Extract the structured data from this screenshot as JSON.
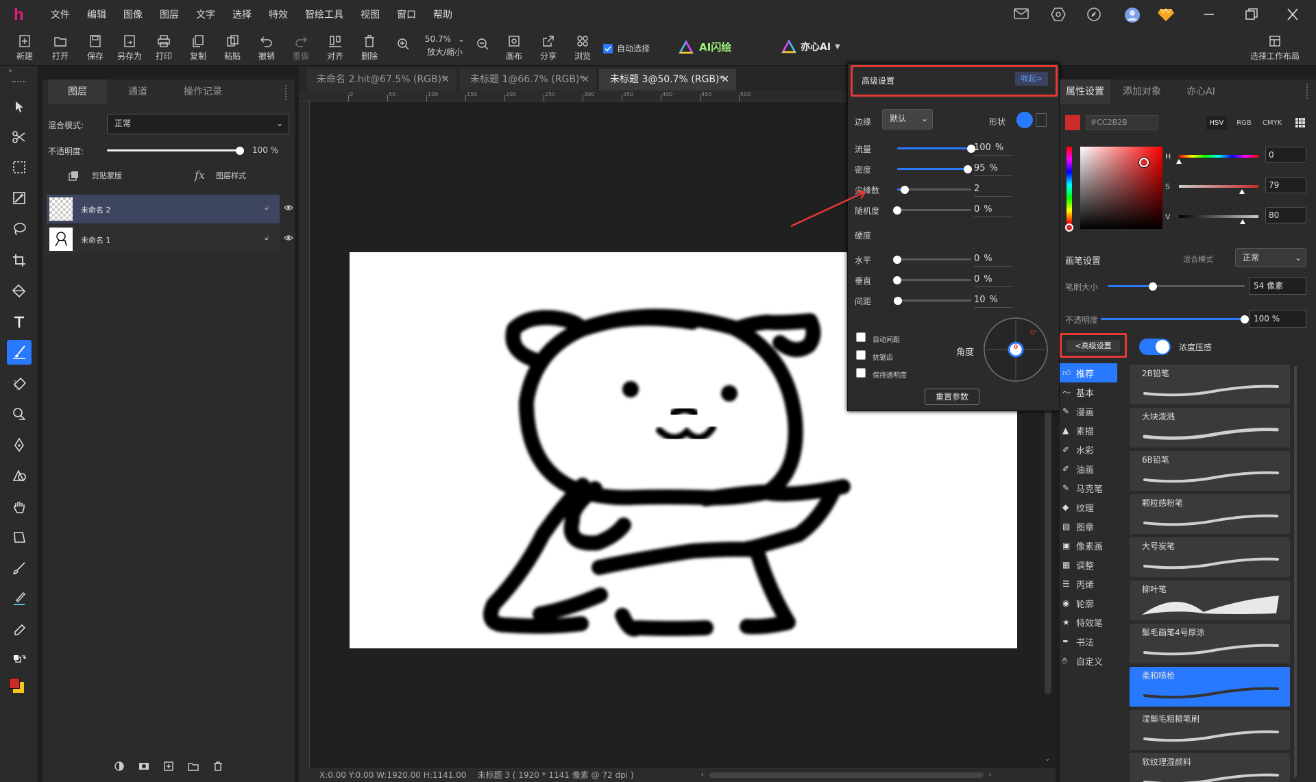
{
  "menubar": {
    "logo": "h",
    "items": [
      "文件",
      "编辑",
      "图像",
      "图层",
      "文字",
      "选择",
      "特效",
      "智绘工具",
      "视图",
      "窗口",
      "帮助"
    ]
  },
  "toolbar": {
    "buttons": [
      "新建",
      "打开",
      "保存",
      "另存为",
      "打印",
      "复制",
      "粘贴",
      "撤销",
      "重做",
      "对齐",
      "删除"
    ],
    "zoom_value": "50.7%",
    "zoom_label": "放大/缩小",
    "canvas_label": "画布",
    "share_label": "分享",
    "browse_label": "浏览",
    "auto_select": "自动选择",
    "ai_flash": "AI闪绘",
    "yixin_ai": "亦心AI",
    "layout_label": "选择工作布局"
  },
  "layers_panel": {
    "tabs": [
      "图层",
      "通道",
      "操作记录"
    ],
    "blend_label": "混合模式:",
    "blend_value": "正常",
    "opacity_label": "不透明度:",
    "opacity_value": "100",
    "opacity_unit": "%",
    "opacity_fraction": 1.0,
    "clip_mask": "剪贴蒙版",
    "layer_style": "图层样式",
    "layers": [
      {
        "name": "未命名 2",
        "selected": true
      },
      {
        "name": "未命名 1",
        "selected": false
      }
    ]
  },
  "doc_tabs": [
    {
      "title": "未命名 2.hit@67.5% (RGB)*",
      "active": false
    },
    {
      "title": "未标题 1@66.7% (RGB)*",
      "active": false
    },
    {
      "title": "未标题 3@50.7% (RGB)*",
      "active": true
    }
  ],
  "ruler_ticks": [
    "0",
    "50",
    "100",
    "150",
    "200",
    "250",
    "300",
    "350",
    "400",
    "450",
    "500"
  ],
  "status": {
    "coords": "X:0.00 Y:0.00 W:1920.00 H:1141.00",
    "doc_info": "未标题 3 ( 1920 * 1141 像素 @ 72 dpi )"
  },
  "advanced": {
    "title": "高级设置",
    "collapse": "收起>",
    "edge_label": "边缘",
    "edge_value": "默认",
    "shape_label": "形状",
    "sliders": [
      {
        "label": "流量",
        "value": "100",
        "unit": "%",
        "fraction": 1.0
      },
      {
        "label": "密度",
        "value": "95",
        "unit": "%",
        "fraction": 0.95
      },
      {
        "label": "尖峰数",
        "value": "2",
        "unit": "",
        "fraction": 0.1
      },
      {
        "label": "随机度",
        "value": "0",
        "unit": "%",
        "fraction": 0.0
      }
    ],
    "hardness_label": "硬度",
    "sliders2": [
      {
        "label": "水平",
        "value": "0",
        "unit": "%",
        "fraction": 0.0
      },
      {
        "label": "垂直",
        "value": "0",
        "unit": "%",
        "fraction": 0.0
      },
      {
        "label": "间距",
        "value": "10",
        "unit": "%",
        "fraction": 0.01
      }
    ],
    "checkboxes": [
      "自动间距",
      "抗锯齿",
      "保持透明度"
    ],
    "angle_label": "角度",
    "angle_value": "0",
    "angle_deg": "0°",
    "reset": "重置参数"
  },
  "right_panel": {
    "tabs": [
      "属性设置",
      "添加对象",
      "亦心AI"
    ],
    "color_hex": "#CC2B2B",
    "color_modes": [
      "HSV",
      "RGB",
      "CMYK"
    ],
    "hsv": [
      {
        "label": "H",
        "value": "0",
        "fraction": 0.0
      },
      {
        "label": "S",
        "value": "79",
        "fraction": 0.79
      },
      {
        "label": "V",
        "value": "80",
        "fraction": 0.8
      }
    ],
    "brush_settings": "画笔设置",
    "blend_label": "混合模式",
    "blend_value": "正常",
    "size_label": "笔刷大小",
    "size_value": "54 像素",
    "size_fraction": 0.33,
    "opacity_label": "不透明度",
    "opacity_value": "100 %",
    "opacity_fraction": 1.0,
    "advanced_btn": "<高级设置",
    "pressure_label": "浓度压感",
    "categories": [
      "推荐",
      "基本",
      "漫画",
      "素描",
      "水彩",
      "油画",
      "马克笔",
      "纹理",
      "图章",
      "像素画",
      "调整",
      "丙烯",
      "轮廓",
      "特效笔",
      "书法",
      "自定义"
    ],
    "active_category": 0,
    "brushes": [
      "2B铅笔",
      "大块泼溅",
      "6B铅笔",
      "颗粒感粉笔",
      "大号炭笔",
      "柳叶笔",
      "鬃毛画笔4号厚涂",
      "柔和喷枪",
      "湿鬃毛粗糙笔刷",
      "软纹理湿颜料"
    ],
    "active_brush": 7
  },
  "colors": {
    "accent": "#2979ff",
    "foreground": "#cc2b2b",
    "background_swatch": "#f5c518",
    "highlight": "#e53935"
  }
}
